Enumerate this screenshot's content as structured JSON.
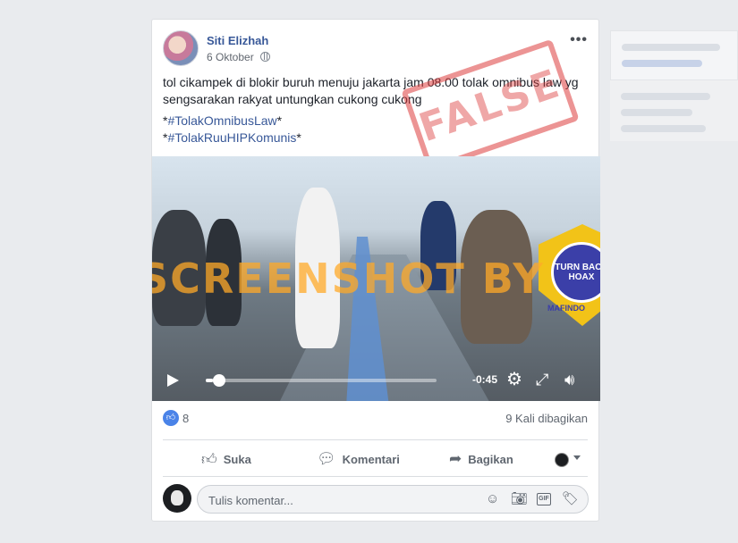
{
  "post": {
    "author": "Siti Elizhah",
    "date": "6 Oktober",
    "text": "tol cikampek di blokir buruh menuju jakarta jam 08.00 tolak omnibus law yg sengsarakan rakyat untungkan cukong cukong",
    "hashtags": [
      {
        "prefix": "*",
        "tag": "#TolakOmnibusLaw",
        "suffix": "*"
      },
      {
        "prefix": "*",
        "tag": "#TolakRuuHIPKomunis",
        "suffix": "*"
      }
    ],
    "stamp": "FALSE"
  },
  "video": {
    "watermark": "SCREENSHOT BY",
    "badge_text": "TURN BACK HOAX",
    "badge_org": "MAFINDO",
    "remaining_time": "-0:45",
    "progress": 0.03
  },
  "stats": {
    "likes": "8",
    "shares": "9 Kali dibagikan"
  },
  "actions": {
    "like": "Suka",
    "comment": "Komentari",
    "share": "Bagikan"
  },
  "comment_box": {
    "placeholder": "Tulis komentar..."
  },
  "colors": {
    "link": "#385898",
    "like": "#4a83e8",
    "background": "#e9ebee"
  }
}
